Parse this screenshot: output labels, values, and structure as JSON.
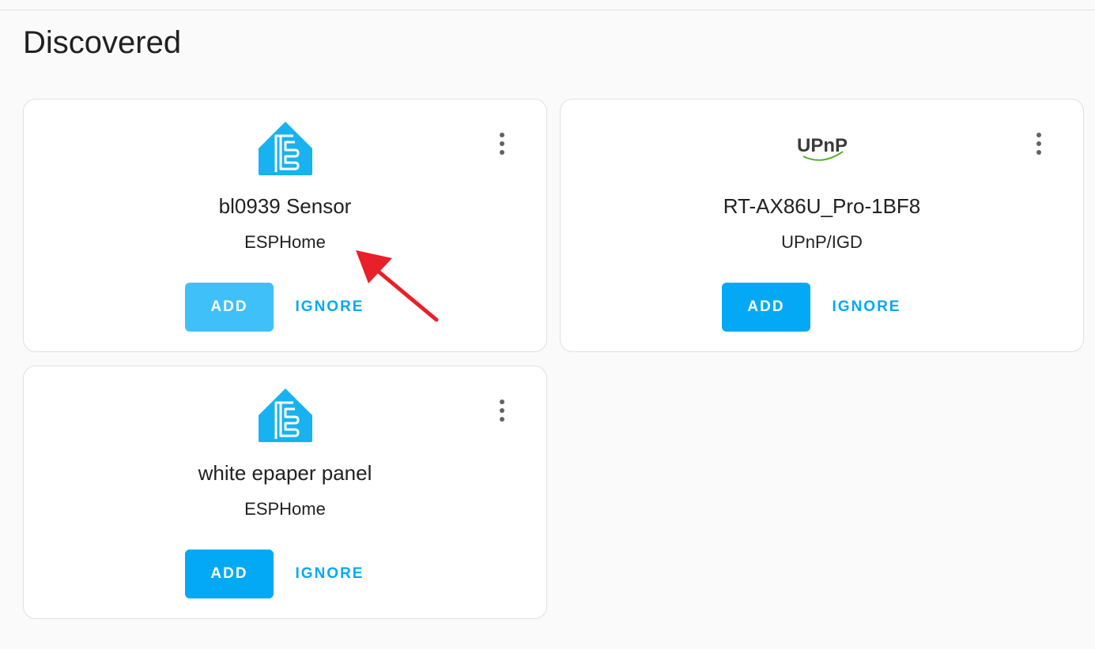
{
  "section": {
    "title": "Discovered"
  },
  "cards": [
    {
      "title": "bl0939 Sensor",
      "subtitle": "ESPHome",
      "logo": "esphome-icon",
      "add_label": "ADD",
      "ignore_label": "IGNORE"
    },
    {
      "title": "RT-AX86U_Pro-1BF8",
      "subtitle": "UPnP/IGD",
      "logo": "upnp-logo",
      "logo_text": "UPnP",
      "add_label": "ADD",
      "ignore_label": "IGNORE"
    },
    {
      "title": "white epaper panel",
      "subtitle": "ESPHome",
      "logo": "esphome-icon",
      "add_label": "ADD",
      "ignore_label": "IGNORE"
    }
  ],
  "colors": {
    "accent": "#03a9f4",
    "esphome": "#18b2f0",
    "annotation_arrow": "#e8202a"
  }
}
